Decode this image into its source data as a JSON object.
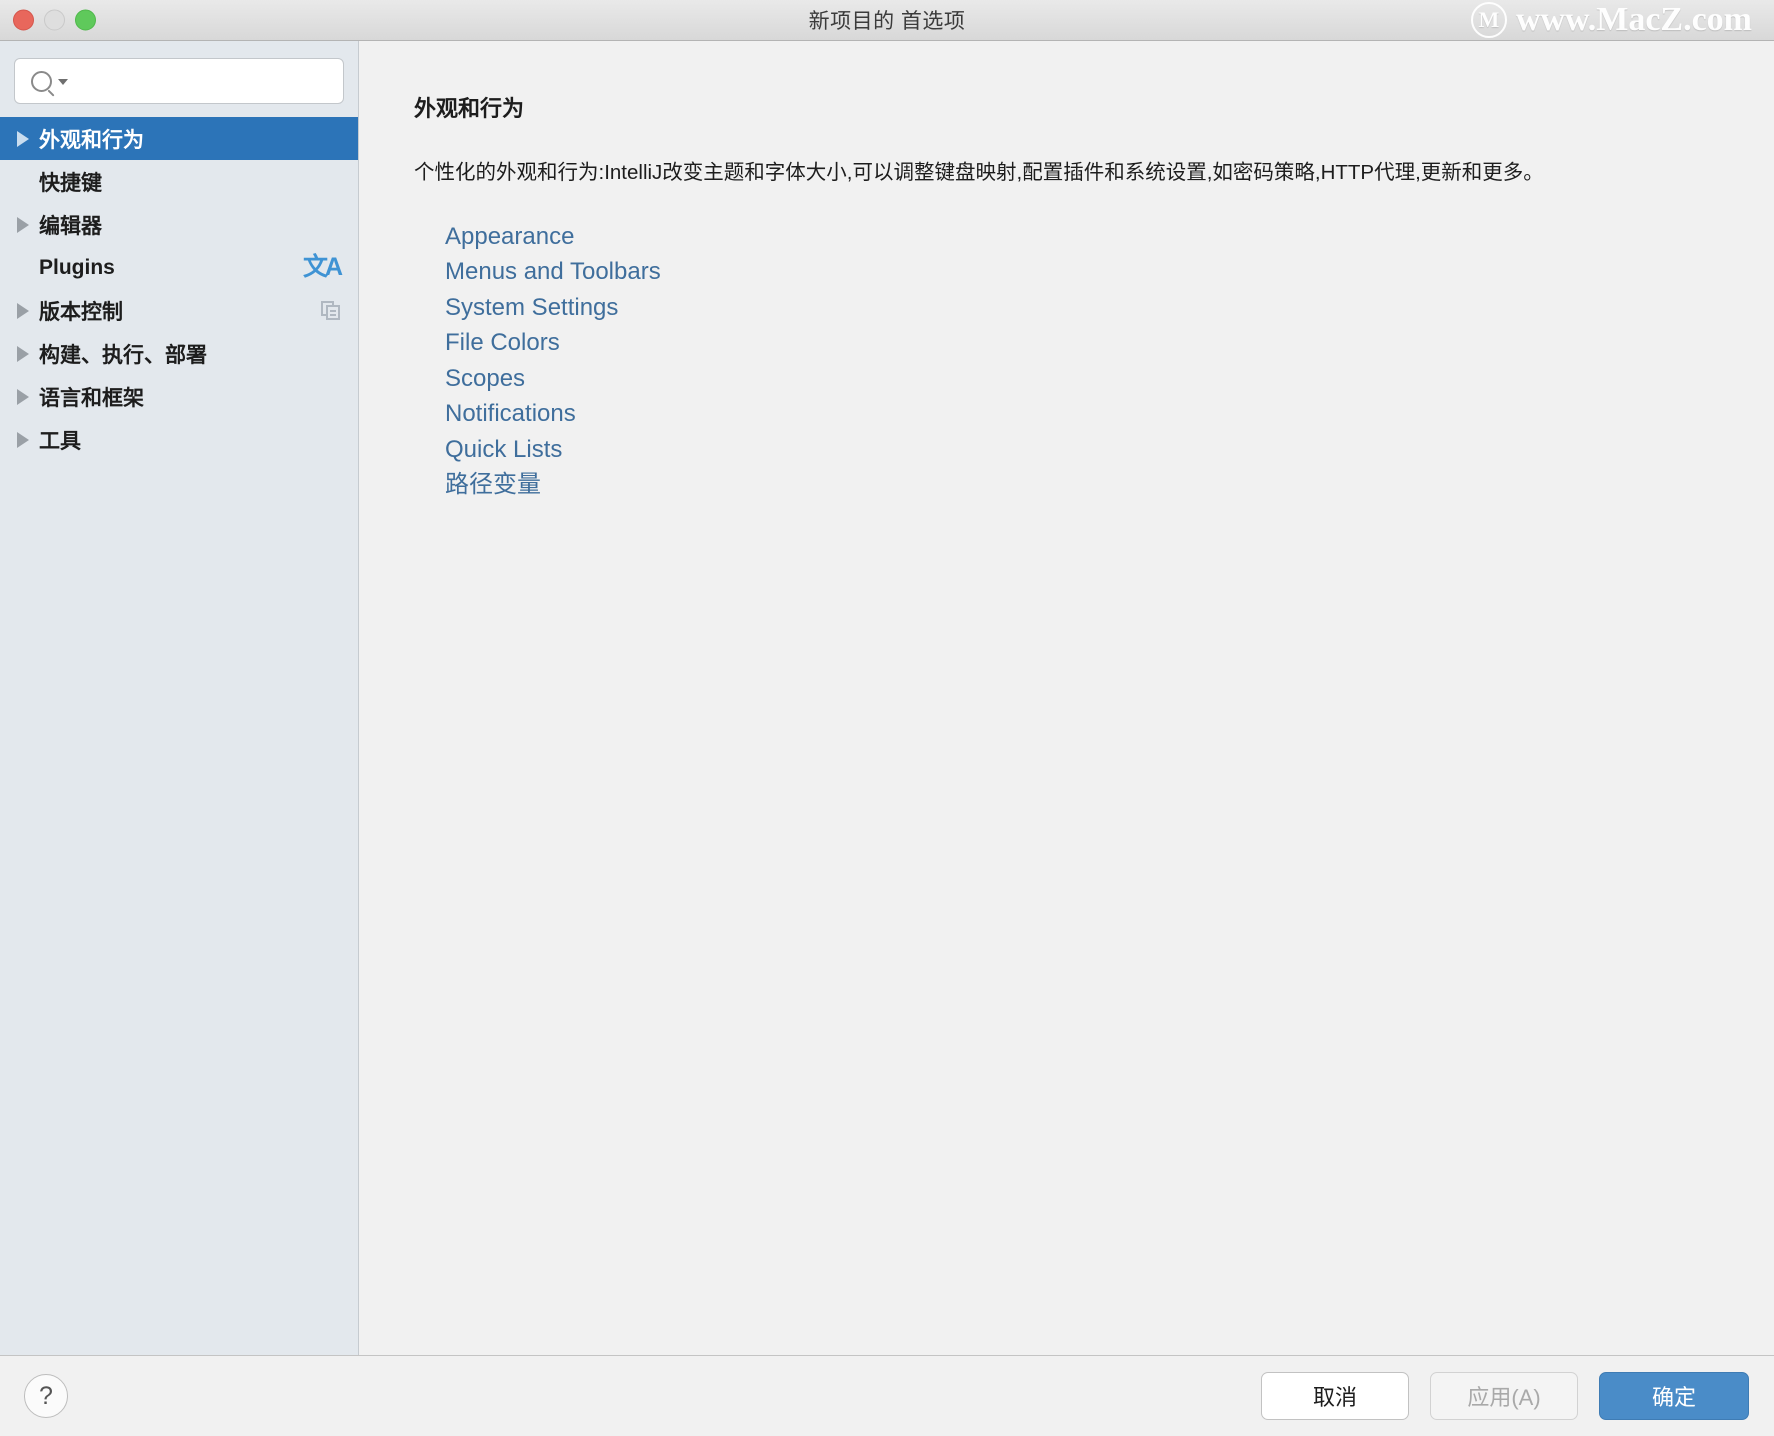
{
  "window": {
    "title": "新项目的 首选项",
    "traffic_lights": [
      "close",
      "minimize",
      "maximize"
    ],
    "watermark": {
      "logo_letter": "M",
      "text": "www.MacZ.com"
    }
  },
  "search": {
    "value": "",
    "placeholder": ""
  },
  "sidebar": {
    "items": [
      {
        "label": "外观和行为",
        "expandable": true,
        "selected": true,
        "badge": "none"
      },
      {
        "label": "快捷键",
        "expandable": false,
        "selected": false,
        "badge": "none"
      },
      {
        "label": "编辑器",
        "expandable": true,
        "selected": false,
        "badge": "none"
      },
      {
        "label": "Plugins",
        "expandable": false,
        "selected": false,
        "badge": "translate"
      },
      {
        "label": "版本控制",
        "expandable": true,
        "selected": false,
        "badge": "copy"
      },
      {
        "label": "构建、执行、部署",
        "expandable": true,
        "selected": false,
        "badge": "none"
      },
      {
        "label": "语言和框架",
        "expandable": true,
        "selected": false,
        "badge": "none"
      },
      {
        "label": "工具",
        "expandable": true,
        "selected": false,
        "badge": "none"
      }
    ],
    "translate_icon_text": "文A"
  },
  "content": {
    "title": "外观和行为",
    "description": "个性化的外观和行为:IntelliJ改变主题和字体大小,可以调整键盘映射,配置插件和系统设置,如密码策略,HTTP代理,更新和更多。",
    "links": [
      "Appearance",
      "Menus and Toolbars",
      "System Settings",
      "File Colors",
      "Scopes",
      "Notifications",
      "Quick Lists",
      "路径变量"
    ]
  },
  "footer": {
    "help_label": "?",
    "cancel_label": "取消",
    "apply_label": "应用(A)",
    "ok_label": "确定"
  },
  "colors": {
    "selection_blue": "#2c74b8",
    "link_blue": "#3f6e9c",
    "ok_button_blue": "#4a8cc8",
    "sidebar_bg": "#e3e8ed",
    "content_bg": "#f1f1f1",
    "translate_icon_blue": "#3f93d4"
  }
}
